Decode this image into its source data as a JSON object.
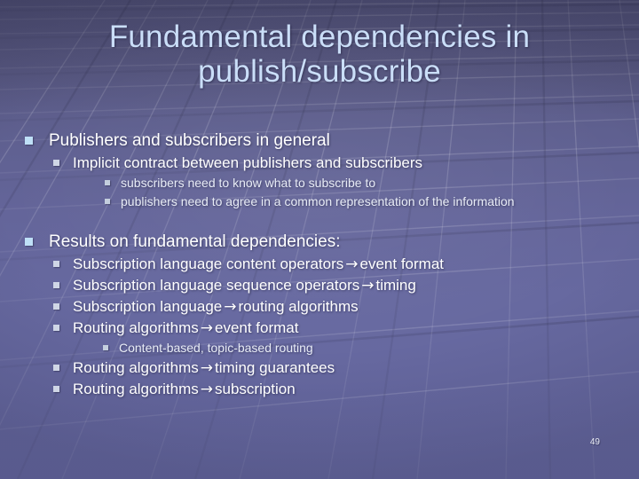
{
  "slide": {
    "title": "Fundamental dependencies in publish/subscribe",
    "page_number": "49",
    "accent_color": "#cadef8",
    "body_text_color": "#ffffff",
    "background_color": "#6769a0",
    "bullet_icon": "square-bullet-icon",
    "arrow_glyph": "→"
  },
  "content": {
    "group1": {
      "heading": "Publishers and subscribers in general",
      "sub": "Implicit contract between publishers and subscribers",
      "subsub": [
        "subscribers need to know what to subscribe to",
        "publishers need to agree in a common representation of the information"
      ]
    },
    "group2": {
      "heading": "Results on fundamental dependencies:",
      "items": [
        {
          "pre": "Subscription language content operators",
          "arrow": "→",
          "post": "event format"
        },
        {
          "pre": "Subscription language sequence operators",
          "arrow": "→",
          "post": "timing"
        },
        {
          "pre": "Subscription language",
          "arrow": "→",
          "post": "routing algorithms"
        },
        {
          "pre": "Routing algorithms",
          "arrow": "→",
          "post": "event format"
        }
      ],
      "nested_note": "Content-based, topic-based routing",
      "items_tail": [
        {
          "pre": "Routing algorithms",
          "arrow": "→",
          "post": "timing guarantees"
        },
        {
          "pre": "Routing algorithms",
          "arrow": "→",
          "post": "subscription"
        }
      ]
    }
  }
}
